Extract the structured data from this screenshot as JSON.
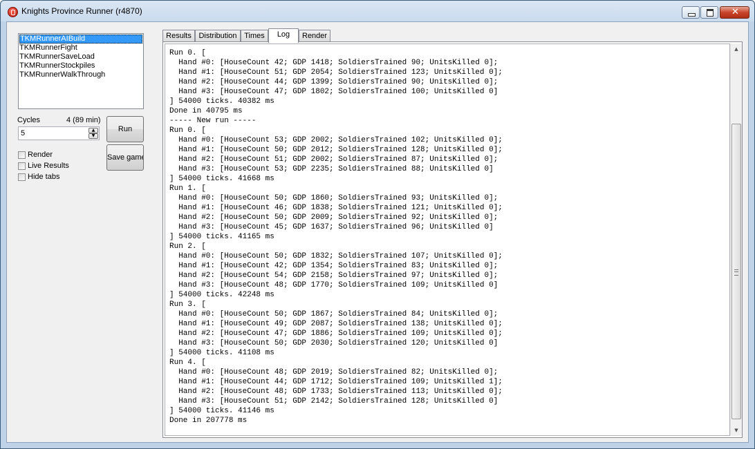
{
  "window": {
    "title": "Knights Province Runner (r4870)"
  },
  "runners": [
    {
      "label": "TKMRunnerAIBuild",
      "selected": true
    },
    {
      "label": "TKMRunnerFight",
      "selected": false
    },
    {
      "label": "TKMRunnerSaveLoad",
      "selected": false
    },
    {
      "label": "TKMRunnerStockpiles",
      "selected": false
    },
    {
      "label": "TKMRunnerWalkThrough",
      "selected": false
    }
  ],
  "controls": {
    "cycles_label": "Cycles",
    "cycles_info": "4 (89 min)",
    "cycles_value": "5",
    "run_label": "Run",
    "save_label": "Save game",
    "render_label": "Render",
    "live_results_label": "Live Results",
    "hide_tabs_label": "Hide tabs"
  },
  "tabs": [
    {
      "label": "Results",
      "active": false
    },
    {
      "label": "Distribution",
      "active": false
    },
    {
      "label": "Times",
      "active": false
    },
    {
      "label": "Log",
      "active": true
    },
    {
      "label": "Render",
      "active": false
    }
  ],
  "log": [
    "Run 0. [",
    "  Hand #0: [HouseCount 42; GDP 1418; SoldiersTrained 90; UnitsKilled 0];",
    "  Hand #1: [HouseCount 51; GDP 2054; SoldiersTrained 123; UnitsKilled 0];",
    "  Hand #2: [HouseCount 44; GDP 1399; SoldiersTrained 90; UnitsKilled 0];",
    "  Hand #3: [HouseCount 47; GDP 1802; SoldiersTrained 100; UnitsKilled 0]",
    "] 54000 ticks. 40382 ms",
    "Done in 40795 ms",
    "----- New run -----",
    "Run 0. [",
    "  Hand #0: [HouseCount 53; GDP 2002; SoldiersTrained 102; UnitsKilled 0];",
    "  Hand #1: [HouseCount 50; GDP 2012; SoldiersTrained 128; UnitsKilled 0];",
    "  Hand #2: [HouseCount 51; GDP 2002; SoldiersTrained 87; UnitsKilled 0];",
    "  Hand #3: [HouseCount 53; GDP 2235; SoldiersTrained 88; UnitsKilled 0]",
    "] 54000 ticks. 41668 ms",
    "Run 1. [",
    "  Hand #0: [HouseCount 50; GDP 1860; SoldiersTrained 93; UnitsKilled 0];",
    "  Hand #1: [HouseCount 46; GDP 1838; SoldiersTrained 121; UnitsKilled 0];",
    "  Hand #2: [HouseCount 50; GDP 2009; SoldiersTrained 92; UnitsKilled 0];",
    "  Hand #3: [HouseCount 45; GDP 1637; SoldiersTrained 96; UnitsKilled 0]",
    "] 54000 ticks. 41165 ms",
    "Run 2. [",
    "  Hand #0: [HouseCount 50; GDP 1832; SoldiersTrained 107; UnitsKilled 0];",
    "  Hand #1: [HouseCount 42; GDP 1354; SoldiersTrained 83; UnitsKilled 0];",
    "  Hand #2: [HouseCount 54; GDP 2158; SoldiersTrained 97; UnitsKilled 0];",
    "  Hand #3: [HouseCount 48; GDP 1770; SoldiersTrained 109; UnitsKilled 0]",
    "] 54000 ticks. 42248 ms",
    "Run 3. [",
    "  Hand #0: [HouseCount 50; GDP 1867; SoldiersTrained 84; UnitsKilled 0];",
    "  Hand #1: [HouseCount 49; GDP 2087; SoldiersTrained 138; UnitsKilled 0];",
    "  Hand #2: [HouseCount 47; GDP 1886; SoldiersTrained 109; UnitsKilled 0];",
    "  Hand #3: [HouseCount 50; GDP 2030; SoldiersTrained 120; UnitsKilled 0]",
    "] 54000 ticks. 41108 ms",
    "Run 4. [",
    "  Hand #0: [HouseCount 48; GDP 2019; SoldiersTrained 82; UnitsKilled 0];",
    "  Hand #1: [HouseCount 44; GDP 1712; SoldiersTrained 109; UnitsKilled 1];",
    "  Hand #2: [HouseCount 48; GDP 1733; SoldiersTrained 113; UnitsKilled 0];",
    "  Hand #3: [HouseCount 51; GDP 2142; SoldiersTrained 128; UnitsKilled 0]",
    "] 54000 ticks. 41146 ms",
    "Done in 207778 ms"
  ]
}
